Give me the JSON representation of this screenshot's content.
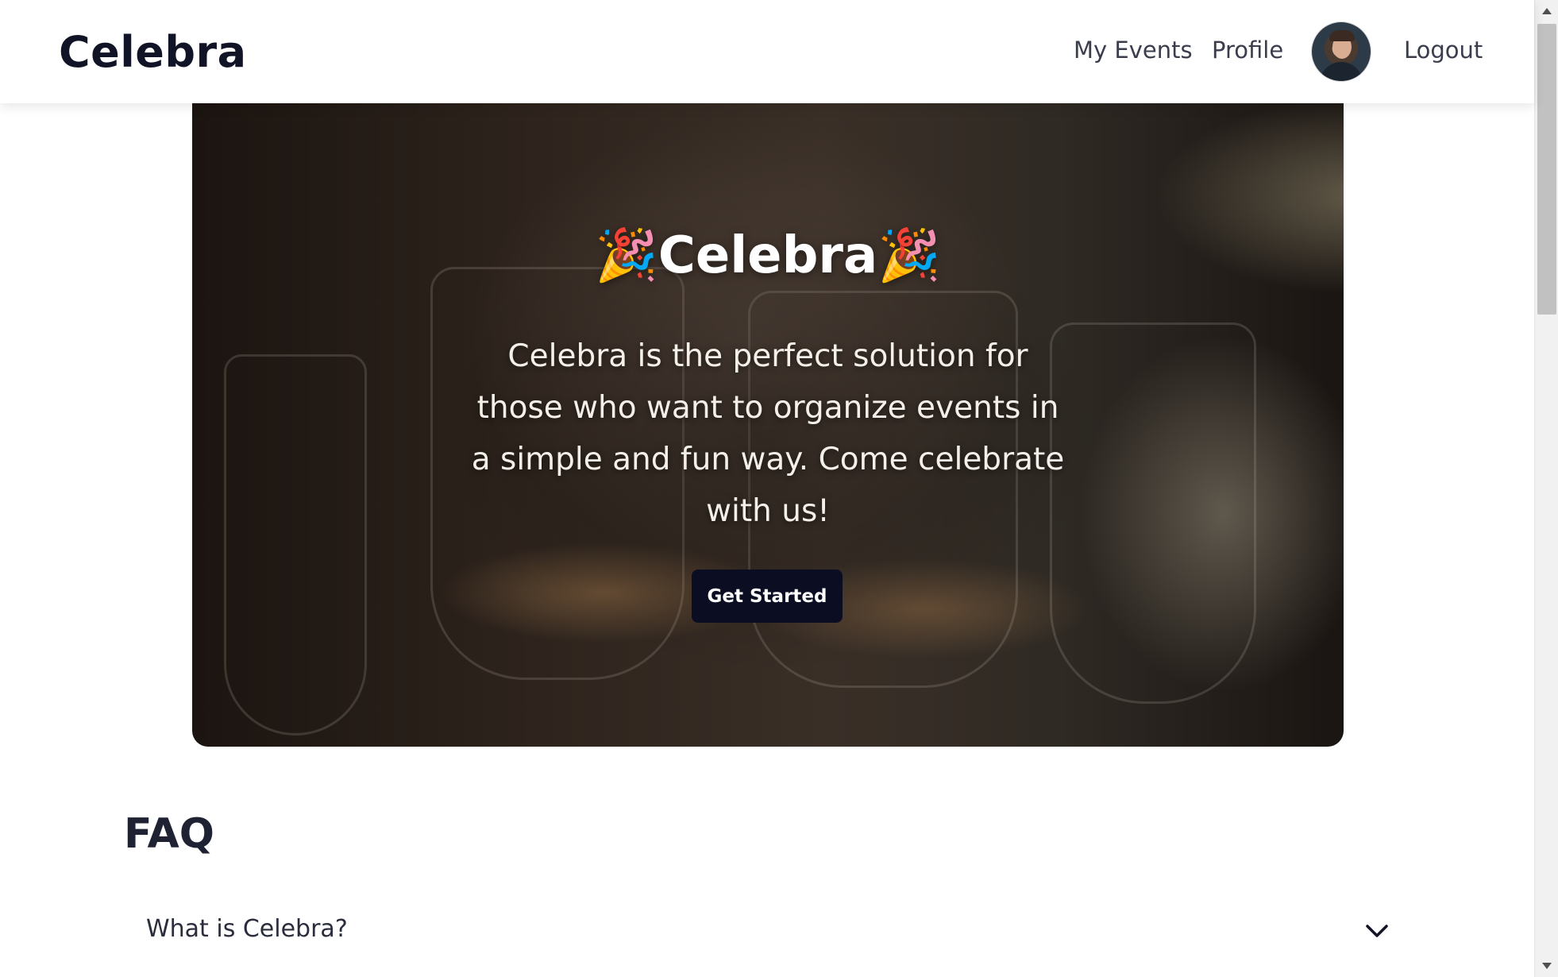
{
  "navbar": {
    "brand": "Celebra",
    "links": {
      "my_events": "My Events",
      "profile": "Profile",
      "logout": "Logout"
    }
  },
  "hero": {
    "title": "🎉Celebra🎉",
    "description": "Celebra is the perfect solution for those who want to organize events in a simple and fun way. Come celebrate with us!",
    "cta_label": "Get Started"
  },
  "faq": {
    "title": "FAQ",
    "items": [
      {
        "question": "What is Celebra?"
      }
    ]
  },
  "colors": {
    "button_bg": "#0b0d22",
    "heading": "#1f2233"
  },
  "icons": {
    "faq_toggle": "chevron-down-icon",
    "avatar": "user-avatar"
  }
}
